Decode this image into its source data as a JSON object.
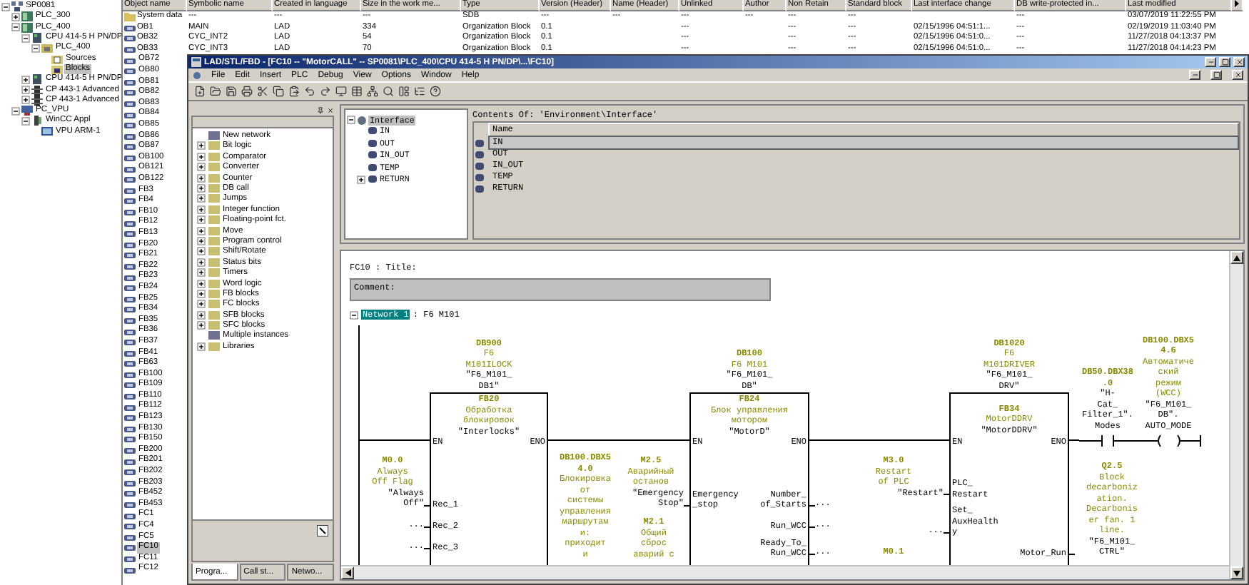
{
  "project_tree": [
    {
      "label": "SP0081",
      "kind": "project",
      "expanded": true,
      "selected": false,
      "children": [
        {
          "label": "PLC_300",
          "kind": "station",
          "expanded": false,
          "selected": false
        },
        {
          "label": "PLC_400",
          "kind": "station",
          "expanded": true,
          "selected": false,
          "children": [
            {
              "label": "CPU 414-5 H PN/DP",
              "kind": "cpu",
              "expanded": true,
              "selected": false,
              "children": [
                {
                  "label": "PLC_400",
                  "kind": "program",
                  "expanded": true,
                  "selected": false,
                  "children": [
                    {
                      "label": "Sources",
                      "kind": "sources",
                      "selected": false
                    },
                    {
                      "label": "Blocks",
                      "kind": "blocks",
                      "selected": true
                    }
                  ]
                }
              ]
            },
            {
              "label": "CPU 414-5 H PN/DP",
              "kind": "cpu",
              "expanded": false,
              "selected": false
            },
            {
              "label": "CP 443-1 Advanced",
              "kind": "cp",
              "expanded": false,
              "selected": false
            },
            {
              "label": "CP 443-1 Advanced",
              "kind": "cp",
              "expanded": false,
              "selected": false
            }
          ]
        },
        {
          "label": "PC_VPU",
          "kind": "pc",
          "expanded": true,
          "selected": false,
          "children": [
            {
              "label": "WinCC Appl",
              "kind": "app",
              "expanded": true,
              "selected": false,
              "children": [
                {
                  "label": "VPU ARM-1",
                  "kind": "hmi",
                  "selected": false
                }
              ]
            }
          ]
        }
      ]
    }
  ],
  "table": {
    "columns": [
      "Object name",
      "Symbolic name",
      "Created in language",
      "Size in the work me...",
      "Type",
      "Version (Header)",
      "Name (Header)",
      "Unlinked",
      "Author",
      "Non Retain",
      "Standard block",
      "Last interface change",
      "DB write-protected in...",
      "Last modified"
    ],
    "rows": [
      {
        "kind": "folder",
        "cells": [
          "System data",
          "---",
          "---",
          "---",
          "SDB",
          "---",
          "---",
          "---",
          "---",
          "---",
          "---",
          null,
          "---",
          "03/07/2019 11:22:55 PM"
        ]
      },
      {
        "kind": "block",
        "cells": [
          "OB1",
          "MAIN",
          "LAD",
          "334",
          "Organization Block",
          "0.1",
          null,
          "---",
          null,
          "---",
          "---",
          "02/15/1996 04:51:1...",
          "---",
          "02/19/2019 11:03:40 PM"
        ]
      },
      {
        "kind": "block",
        "cells": [
          "OB32",
          "CYC_INT2",
          "LAD",
          "54",
          "Organization Block",
          "0.1",
          null,
          "---",
          null,
          "---",
          "---",
          "02/15/1996 04:51:0...",
          "---",
          "11/27/2018 04:13:37 PM"
        ]
      },
      {
        "kind": "block",
        "cells": [
          "OB33",
          "CYC_INT3",
          "LAD",
          "70",
          "Organization Block",
          "0.1",
          null,
          "---",
          null,
          "---",
          "---",
          "02/15/1996 04:51:0...",
          "---",
          "11/27/2018 04:14:23 PM"
        ]
      }
    ]
  },
  "object_list": [
    {
      "name": "OB72",
      "selected": false
    },
    {
      "name": "OB80",
      "selected": false
    },
    {
      "name": "OB81",
      "selected": false
    },
    {
      "name": "OB82",
      "selected": false
    },
    {
      "name": "OB83",
      "selected": false
    },
    {
      "name": "OB84",
      "selected": false
    },
    {
      "name": "OB85",
      "selected": false
    },
    {
      "name": "OB86",
      "selected": false
    },
    {
      "name": "OB87",
      "selected": false
    },
    {
      "name": "OB100",
      "selected": false
    },
    {
      "name": "OB121",
      "selected": false
    },
    {
      "name": "OB122",
      "selected": false
    },
    {
      "name": "FB3",
      "selected": false
    },
    {
      "name": "FB4",
      "selected": false
    },
    {
      "name": "FB10",
      "selected": false
    },
    {
      "name": "FB12",
      "selected": false
    },
    {
      "name": "FB13",
      "selected": false
    },
    {
      "name": "FB20",
      "selected": false
    },
    {
      "name": "FB21",
      "selected": false
    },
    {
      "name": "FB22",
      "selected": false
    },
    {
      "name": "FB23",
      "selected": false
    },
    {
      "name": "FB24",
      "selected": false
    },
    {
      "name": "FB25",
      "selected": false
    },
    {
      "name": "FB34",
      "selected": false
    },
    {
      "name": "FB35",
      "selected": false
    },
    {
      "name": "FB36",
      "selected": false
    },
    {
      "name": "FB37",
      "selected": false
    },
    {
      "name": "FB41",
      "selected": false
    },
    {
      "name": "FB63",
      "selected": false
    },
    {
      "name": "FB100",
      "selected": false
    },
    {
      "name": "FB109",
      "selected": false
    },
    {
      "name": "FB110",
      "selected": false
    },
    {
      "name": "FB112",
      "selected": false
    },
    {
      "name": "FB123",
      "selected": false
    },
    {
      "name": "FB130",
      "selected": false
    },
    {
      "name": "FB150",
      "selected": false
    },
    {
      "name": "FB200",
      "selected": false
    },
    {
      "name": "FB201",
      "selected": false
    },
    {
      "name": "FB202",
      "selected": false
    },
    {
      "name": "FB203",
      "selected": false
    },
    {
      "name": "FB452",
      "selected": false
    },
    {
      "name": "FB453",
      "selected": false
    },
    {
      "name": "FC1",
      "selected": false
    },
    {
      "name": "FC4",
      "selected": false
    },
    {
      "name": "FC5",
      "selected": false
    },
    {
      "name": "FC10",
      "selected": true
    },
    {
      "name": "FC11",
      "selected": false
    },
    {
      "name": "FC12",
      "selected": false
    }
  ],
  "editor_window": {
    "title": "LAD/STL/FBD - [FC10 -- \"MotorCALL\" -- SP0081\\PLC_400\\CPU 414-5 H PN/DP\\...\\FC10]",
    "menu": [
      "File",
      "Edit",
      "Insert",
      "PLC",
      "Debug",
      "View",
      "Options",
      "Window",
      "Help"
    ],
    "instructions": [
      {
        "label": "New network"
      },
      {
        "label": "Bit logic",
        "expanded": false
      },
      {
        "label": "Comparator",
        "expanded": false
      },
      {
        "label": "Converter",
        "expanded": false
      },
      {
        "label": "Counter",
        "expanded": false
      },
      {
        "label": "DB call",
        "expanded": false
      },
      {
        "label": "Jumps",
        "expanded": false
      },
      {
        "label": "Integer function",
        "expanded": false
      },
      {
        "label": "Floating-point fct.",
        "expanded": false
      },
      {
        "label": "Move",
        "expanded": false
      },
      {
        "label": "Program control",
        "expanded": false
      },
      {
        "label": "Shift/Rotate",
        "expanded": false
      },
      {
        "label": "Status bits",
        "expanded": false
      },
      {
        "label": "Timers",
        "expanded": false
      },
      {
        "label": "Word logic",
        "expanded": false
      },
      {
        "label": "FB blocks",
        "expanded": false
      },
      {
        "label": "FC blocks",
        "expanded": false
      },
      {
        "label": "SFB blocks",
        "expanded": false
      },
      {
        "label": "SFC blocks",
        "expanded": false
      },
      {
        "label": "Multiple instances"
      },
      {
        "label": "Libraries",
        "expanded": false
      }
    ],
    "panel_tabs": [
      {
        "label": "Progra...",
        "selected": true
      },
      {
        "label": "Call st...",
        "selected": false
      },
      {
        "label": "Netwo...",
        "selected": false
      }
    ],
    "interface_tree": {
      "label": "Interface",
      "expanded": true,
      "selected": true,
      "children": [
        {
          "label": "IN"
        },
        {
          "label": "OUT"
        },
        {
          "label": "IN_OUT"
        },
        {
          "label": "TEMP"
        },
        {
          "label": "RETURN",
          "expanded": false
        }
      ]
    },
    "contents_label": "Contents Of: 'Environment\\Interface'",
    "contents_column": "Name",
    "contents_rows": [
      {
        "label": "IN",
        "selected": true
      },
      {
        "label": "OUT",
        "selected": false
      },
      {
        "label": "IN_OUT",
        "selected": false
      },
      {
        "label": "TEMP",
        "selected": false
      },
      {
        "label": "RETURN",
        "selected": false
      }
    ],
    "block_title": "FC10 : Title:",
    "comment": "Comment:",
    "network": {
      "label": "Network 1",
      "selected": true,
      "expanded": true,
      "title": ": F6 M101",
      "boxes": [
        {
          "instance": {
            "address": [
              "DB900"
            ],
            "comment": [
              "F6",
              "M101ILOCK"
            ],
            "symbol": [
              "\"F6_M101_",
              "DB1\""
            ]
          },
          "block": {
            "address": [
              "FB20"
            ],
            "comment": [
              "Обработка",
              "блокировок"
            ],
            "symbol": [
              "\"Interlocks\""
            ]
          },
          "en": "EN",
          "eno": "ENO",
          "inputs": [
            {
              "pin": [
                "Rec_1"
              ],
              "operand": {
                "address": [
                  "M0.0"
                ],
                "comment": [
                  "Always",
                  "Off Flag"
                ],
                "symbol": [
                  "\"Always",
                  "Off\""
                ]
              }
            },
            {
              "pin": [
                "Rec_2"
              ],
              "operand": {
                "symbol": [
                  "..."
                ]
              }
            },
            {
              "pin": [
                "Rec_3"
              ],
              "operand": {
                "symbol": [
                  "..."
                ]
              }
            }
          ]
        },
        {
          "instance": {
            "address": [
              "DB100"
            ],
            "comment": [
              "F6 M101"
            ],
            "symbol": [
              "\"F6_M101_",
              "DB\""
            ]
          },
          "block": {
            "address": [
              "FB24"
            ],
            "comment": [
              "Блок управления",
              "мотором"
            ],
            "symbol": [
              "\"MotorD\""
            ]
          },
          "en": "EN",
          "eno": "ENO",
          "inputs": [
            {
              "pin": [
                "Emergency",
                "_stop"
              ],
              "operand": {
                "address": [
                  "M2.5"
                ],
                "comment": [
                  "Аварийный",
                  "останов"
                ],
                "symbol": [
                  "\"Emergency",
                  "Stop\""
                ]
              }
            }
          ],
          "outputs": [
            {
              "pin": [
                "Number_",
                "of_Starts"
              ],
              "operand": {
                "symbol": [
                  "..."
                ]
              }
            },
            {
              "pin": [
                "Run_WCC"
              ],
              "operand": {
                "symbol": [
                  "..."
                ]
              }
            },
            {
              "pin": [
                "Ready_To_",
                "Run_WCC"
              ],
              "operand": {
                "symbol": [
                  "..."
                ]
              }
            }
          ]
        },
        {
          "instance": {
            "address": [
              "DB1020"
            ],
            "comment": [
              "F6",
              "M101DRIVER"
            ],
            "symbol": [
              "\"F6_M101_",
              "DRV\""
            ]
          },
          "block": {
            "address": [
              "FB34"
            ],
            "comment": [
              "MotorDDRV"
            ],
            "symbol": [
              "\"MotorDDRV\""
            ]
          },
          "en": "EN",
          "eno": "ENO",
          "inputs": [
            {
              "pin": [
                "PLC_",
                "Restart"
              ],
              "operand": {
                "address": [
                  "M3.0"
                ],
                "comment": [
                  "Restart",
                  "of PLC"
                ],
                "symbol": [
                  "\"Restart\""
                ]
              }
            },
            {
              "pin": [
                "Set_",
                "AuxHealth",
                "y"
              ],
              "operand": {
                "symbol": [
                  "..."
                ]
              }
            },
            {
              "operand": {
                "address": [
                  "M0.1"
                ]
              }
            }
          ],
          "outputs": [
            {
              "pin": [
                "Motor_Run"
              ],
              "operand": {
                "address": [
                  "Q2.5"
                ],
                "comment": [
                  "Block",
                  "decarboniz",
                  "ation.",
                  "Decarbonis",
                  "er fan. 1",
                  "line."
                ],
                "symbol": [
                  "\"F6_M101_",
                  "CTRL\""
                ]
              }
            }
          ]
        }
      ],
      "notes": [
        {
          "address": [
            "DB100.DBX5",
            "4.0"
          ],
          "comment": [
            "Блокировка",
            "от",
            "системы",
            "управления",
            "маршрутам",
            "и:",
            "приходит",
            "и"
          ]
        },
        {
          "address": [
            "M2.1"
          ],
          "comment": [
            "Общий",
            "сброс",
            "аварий с"
          ]
        }
      ],
      "contact": {
        "address": [
          "DB50.DBX38",
          ".0"
        ],
        "symbol": [
          "\"H-",
          "Cat_",
          "Filter_1\".",
          "Modes"
        ]
      },
      "coil": {
        "address": [
          "DB100.DBX5",
          "4.6"
        ],
        "comment": [
          "Автоматиче",
          "ский",
          "режим",
          "(WCC)"
        ],
        "symbol": [
          "\"F6_M101_",
          "DB\".",
          "AUTO_MODE"
        ]
      }
    }
  }
}
